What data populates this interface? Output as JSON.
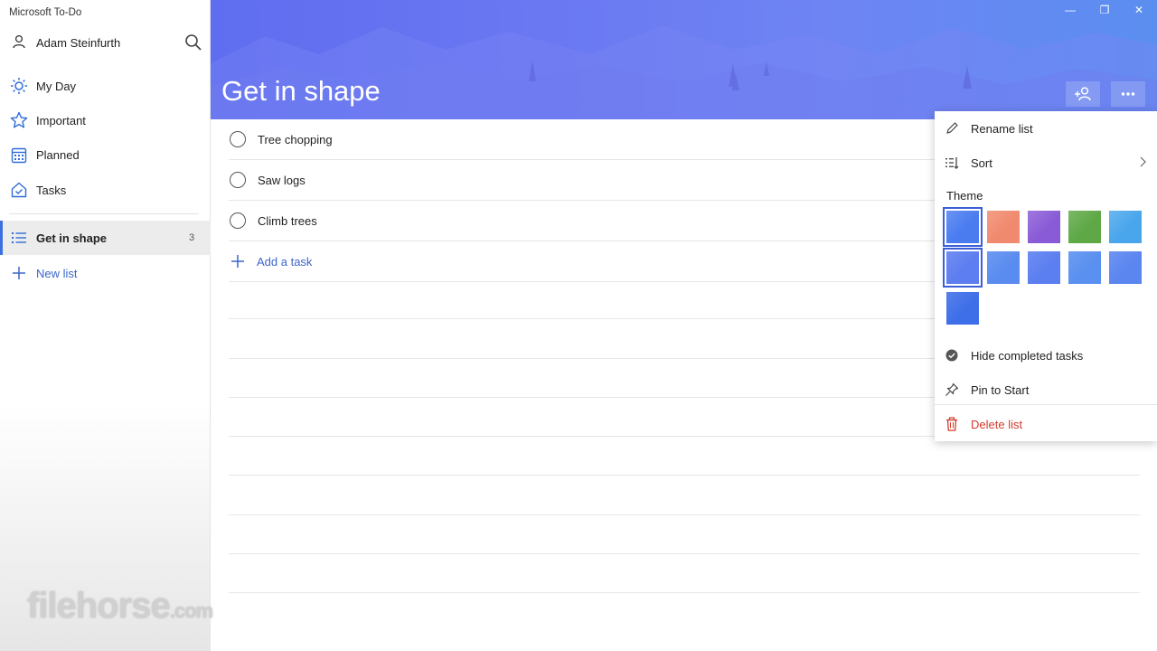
{
  "app": {
    "title": "Microsoft To-Do"
  },
  "user": {
    "name": "Adam Steinfurth"
  },
  "sidebar": {
    "nav": [
      {
        "label": "My Day",
        "icon": "sun-icon"
      },
      {
        "label": "Important",
        "icon": "star-icon"
      },
      {
        "label": "Planned",
        "icon": "calendar-icon"
      },
      {
        "label": "Tasks",
        "icon": "home-check-icon"
      }
    ],
    "lists": [
      {
        "label": "Get in shape",
        "count": "3",
        "icon": "list-icon",
        "selected": true
      }
    ],
    "new_list_label": "New list"
  },
  "header": {
    "list_title": "Get in shape",
    "share_icon": "add-person-icon",
    "more_icon": "more-dots-icon",
    "window_controls": [
      "—",
      "❐",
      "✕"
    ]
  },
  "tasks": [
    {
      "title": "Tree chopping"
    },
    {
      "title": "Saw logs"
    },
    {
      "title": "Climb trees"
    }
  ],
  "add_task_label": "Add a task",
  "menu": {
    "rename": "Rename list",
    "sort": "Sort",
    "theme_label": "Theme",
    "hide_completed": "Hide completed tasks",
    "pin": "Pin to Start",
    "delete": "Delete list",
    "theme_colors": [
      "#4a7cf0",
      "#f08a6e",
      "#8a5bd6",
      "#5ea846",
      "#4aa6ec",
      "#5d7ef0",
      "#5a8cf0",
      "#5b7ff0",
      "#5a90f0",
      "#5b86f0",
      "#3f6fe8"
    ],
    "selected_theme_indices": [
      0,
      5
    ]
  },
  "colors": {
    "accent": "#3c66c9",
    "delete_red": "#d13b2b",
    "header_start": "#5f6df0",
    "header_end": "#5b8ef0"
  },
  "watermark": {
    "text": "filehorse",
    "suffix": ".com"
  }
}
